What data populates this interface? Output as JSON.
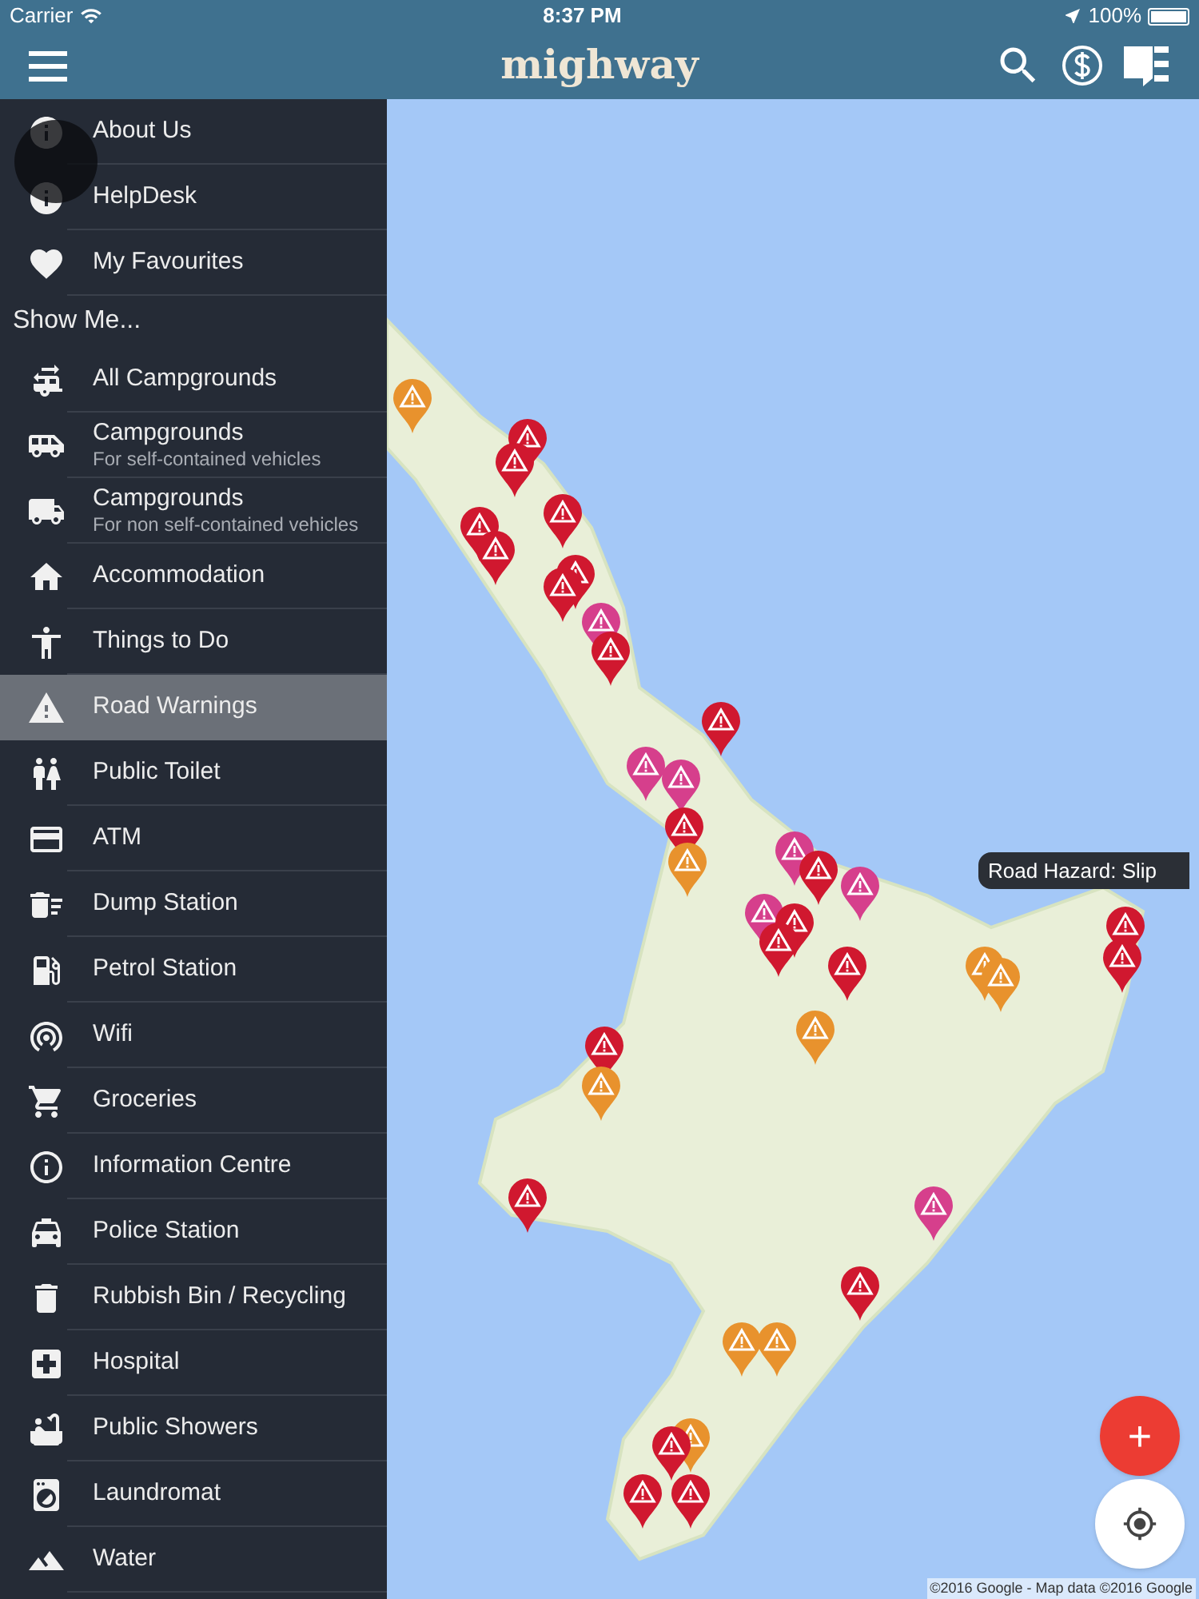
{
  "status_bar": {
    "carrier": "Carrier",
    "time": "8:37 PM",
    "battery": "100%"
  },
  "header": {
    "logo": "mighway"
  },
  "sidebar": {
    "top_items": [
      {
        "label": "About Us",
        "selected": false
      },
      {
        "label": "HelpDesk",
        "selected": false
      },
      {
        "label": "My Favourites",
        "selected": false
      }
    ],
    "section_title": "Show Me...",
    "items": [
      {
        "label": "All Campgrounds",
        "selected": false
      },
      {
        "label": "Campgrounds",
        "sublabel": "For self-contained vehicles",
        "selected": false
      },
      {
        "label": "Campgrounds",
        "sublabel": "For non self-contained vehicles",
        "selected": false
      },
      {
        "label": "Accommodation",
        "selected": false
      },
      {
        "label": "Things to Do",
        "selected": false
      },
      {
        "label": "Road Warnings",
        "selected": true
      },
      {
        "label": "Public Toilet",
        "selected": false
      },
      {
        "label": "ATM",
        "selected": false
      },
      {
        "label": "Dump Station",
        "selected": false
      },
      {
        "label": "Petrol Station",
        "selected": false
      },
      {
        "label": "Wifi",
        "selected": false
      },
      {
        "label": "Groceries",
        "selected": false
      },
      {
        "label": "Information Centre",
        "selected": false
      },
      {
        "label": "Police Station",
        "selected": false
      },
      {
        "label": "Rubbish Bin / Recycling",
        "selected": false
      },
      {
        "label": "Hospital",
        "selected": false
      },
      {
        "label": "Public Showers",
        "selected": false
      },
      {
        "label": "Laundromat",
        "selected": false
      },
      {
        "label": "Water",
        "selected": false
      }
    ]
  },
  "map": {
    "tooltip": "Road Hazard: Slip",
    "add_button": "+",
    "attribution": "©2016 Google - Map data ©2016 Google"
  }
}
